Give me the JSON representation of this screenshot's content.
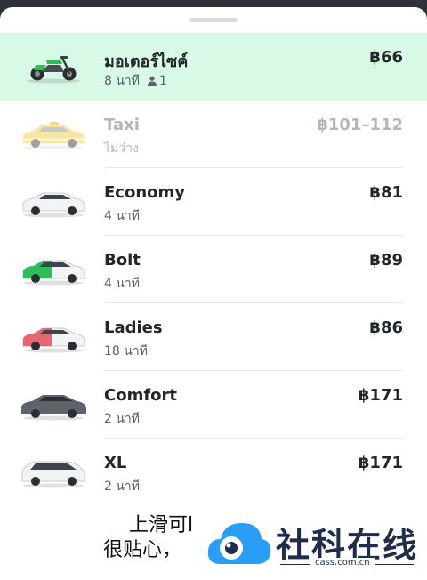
{
  "options": [
    {
      "name": "มอเตอร์ไซค์",
      "eta": "8 นาที",
      "seats": "1",
      "price": "฿66",
      "state": "selected",
      "vehicle_icon": "motorbike-icon"
    },
    {
      "name": "Taxi",
      "eta": "ไม่ว่าง",
      "price": "฿101–112",
      "state": "unavailable",
      "vehicle_icon": "taxi-icon"
    },
    {
      "name": "Economy",
      "eta": "4 นาที",
      "price": "฿81",
      "state": "available",
      "vehicle_icon": "white-sedan-icon"
    },
    {
      "name": "Bolt",
      "eta": "4 นาที",
      "price": "฿89",
      "state": "available",
      "vehicle_icon": "bolt-green-car-icon"
    },
    {
      "name": "Ladies",
      "eta": "18 นาที",
      "price": "฿86",
      "state": "available",
      "vehicle_icon": "ladies-pink-car-icon"
    },
    {
      "name": "Comfort",
      "eta": "2 นาที",
      "price": "฿171",
      "state": "available",
      "vehicle_icon": "grey-sedan-icon"
    },
    {
      "name": "XL",
      "eta": "2 นาที",
      "price": "฿171",
      "state": "available",
      "vehicle_icon": "minivan-icon"
    }
  ],
  "overlay": {
    "caption_line1": "上滑可l",
    "caption_line2": "很贴心，",
    "watermark_text": "社科在线",
    "watermark_domain": "cass.com.cn"
  },
  "colors": {
    "selected_row": "#d8f9e6",
    "brand_green": "#2dbd5a",
    "text_primary": "#222529",
    "text_disabled": "#b3b6ba"
  }
}
